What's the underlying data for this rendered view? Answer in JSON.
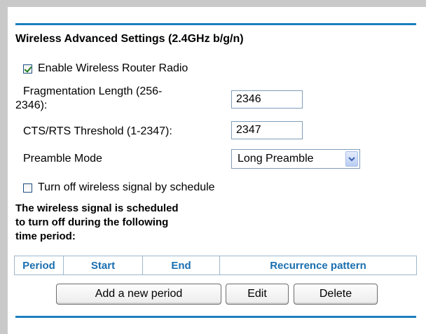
{
  "section": {
    "title": "Wireless Advanced Settings (2.4GHz b/g/n)"
  },
  "enable_radio": {
    "label": "Enable Wireless Router Radio",
    "checked": true
  },
  "fragmentation": {
    "label_line1": "Fragmentation Length (256-",
    "label_line2": "2346):",
    "value": "2346"
  },
  "cts_rts": {
    "label": "CTS/RTS Threshold (1-2347):",
    "value": "2347"
  },
  "preamble": {
    "label": "Preamble Mode",
    "selected": "Long Preamble"
  },
  "schedule": {
    "toggle_label": "Turn off wireless signal by schedule",
    "checked": false,
    "description_line1": "The wireless signal is scheduled",
    "description_line2": "to turn off during the following",
    "description_line3": "time period:",
    "columns": [
      "Period",
      "Start",
      "End",
      "Recurrence pattern"
    ]
  },
  "buttons": {
    "add": "Add a new period",
    "edit": "Edit",
    "delete": "Delete"
  },
  "colors": {
    "accent_rule": "#1c7fbe",
    "header_text": "#1a6fb0"
  }
}
